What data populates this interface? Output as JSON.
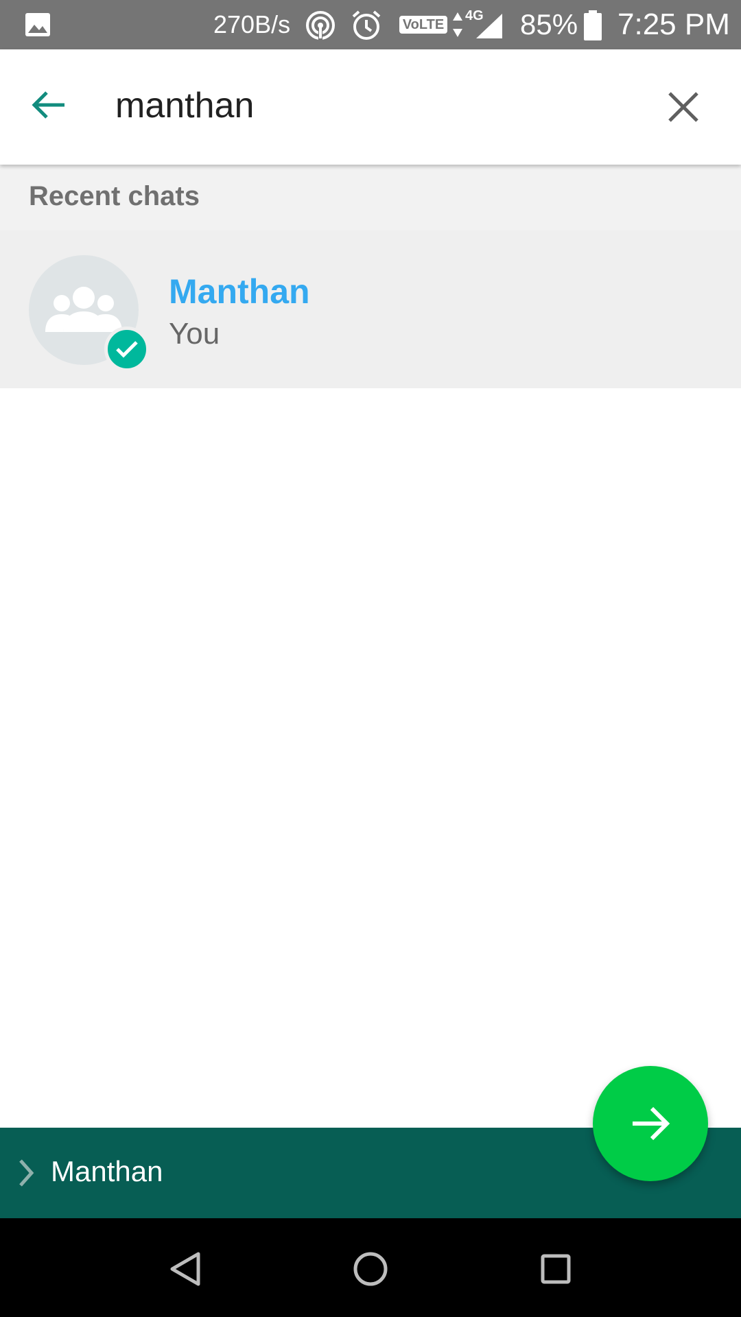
{
  "status_bar": {
    "net_speed": "270B/s",
    "volte": "VoLTE",
    "network_type": "4G",
    "battery": "85%",
    "time": "7:25 PM"
  },
  "search": {
    "query": "manthan",
    "back_icon": "arrow-left-icon",
    "clear_icon": "close-icon"
  },
  "section": {
    "title": "Recent chats"
  },
  "chats": [
    {
      "name": "Manthan",
      "subtitle": "You",
      "avatar": "group-icon",
      "selected": true
    }
  ],
  "selection_bar": {
    "selected_name": "Manthan"
  },
  "fab": {
    "icon": "arrow-right-icon"
  },
  "colors": {
    "status_bar": "#757575",
    "accent_teal": "#075e54",
    "fab_green": "#00cc47",
    "name_blue": "#34a9f0",
    "check_teal": "#00b89c"
  }
}
